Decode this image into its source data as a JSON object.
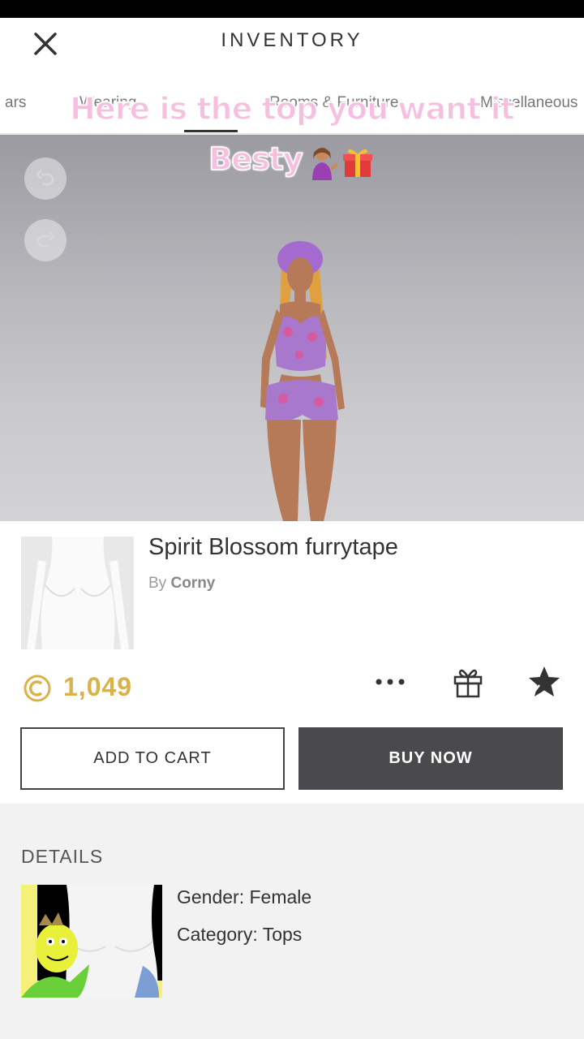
{
  "header": {
    "title": "INVENTORY"
  },
  "tabs": [
    {
      "label": "ars"
    },
    {
      "label": "Wearing"
    },
    {
      "label": "Rooms & Furniture"
    },
    {
      "label": "Miscellaneous"
    }
  ],
  "overlay": {
    "line1": "Here is the top you want it",
    "line2": "Besty"
  },
  "product": {
    "name": "Spirit Blossom furrytape",
    "by_label": "By",
    "creator": "Corny",
    "price": "1,049"
  },
  "actions": {
    "add_to_cart": "ADD TO CART",
    "buy_now": "BUY NOW"
  },
  "details": {
    "title": "DETAILS",
    "gender": "Gender: Female",
    "category": "Category: Tops"
  },
  "colors": {
    "accent_gold": "#d9b24a",
    "buy_button": "#4a4a4c",
    "caption_pink": "#f6bfe0"
  },
  "icons": [
    "close-icon",
    "undo-icon",
    "redo-icon",
    "coin-icon",
    "more-icon",
    "gift-icon",
    "favorite-star-icon"
  ]
}
